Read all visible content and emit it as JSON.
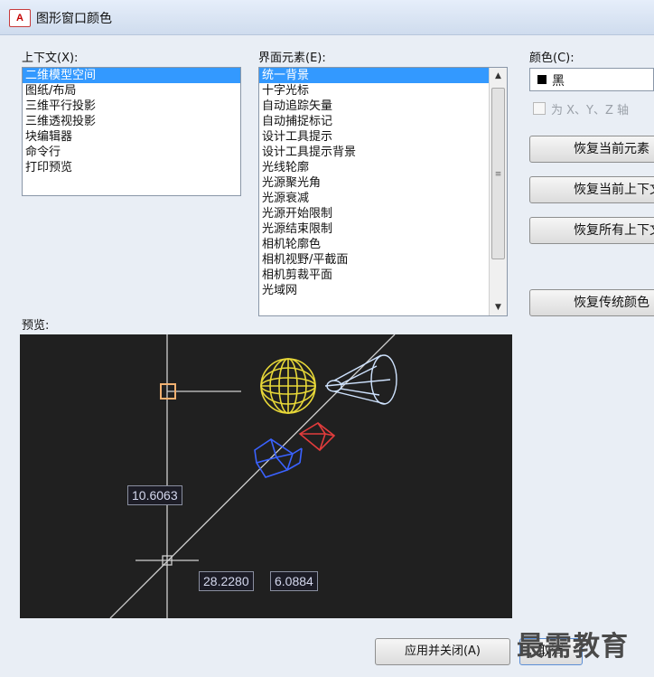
{
  "window": {
    "icon_text": "A",
    "title": "图形窗口颜色"
  },
  "context": {
    "label": "上下文(X):",
    "items": [
      "二维模型空间",
      "图纸/布局",
      "三维平行投影",
      "三维透视投影",
      "块编辑器",
      "命令行",
      "打印预览"
    ],
    "selected_index": 0
  },
  "elements": {
    "label": "界面元素(E):",
    "items": [
      "统一背景",
      "十字光标",
      "自动追踪矢量",
      "自动捕捉标记",
      "设计工具提示",
      "设计工具提示背景",
      "光线轮廓",
      "光源聚光角",
      "光源衰减",
      "光源开始限制",
      "光源结束限制",
      "相机轮廓色",
      "相机视野/平截面",
      "相机剪裁平面",
      "光域网"
    ],
    "selected_index": 0
  },
  "color": {
    "label": "颜色(C):",
    "value": "黑",
    "swatch": "#000000",
    "tint_label": "为 X、Y、Z 轴"
  },
  "buttons": {
    "restore_current_element": "恢复当前元素",
    "restore_current_context": "恢复当前上下文",
    "restore_all_contexts": "恢复所有上下文",
    "restore_classic": "恢复传统颜色",
    "apply_close": "应用并关闭(A)",
    "cancel": "取消"
  },
  "preview": {
    "label": "预览:",
    "dim_y": "10.6063",
    "dim_x1": "28.2280",
    "dim_x2": "6.0884"
  },
  "watermark": "最需教育",
  "colors": {
    "selection": "#3399ff",
    "preview_bg": "#202020",
    "sphere": "#e8d838",
    "light_cone": "#cfe3ff",
    "camera_red": "#e23c3c",
    "camera_blue": "#3a62ff",
    "pickbox": "#f0b070"
  }
}
